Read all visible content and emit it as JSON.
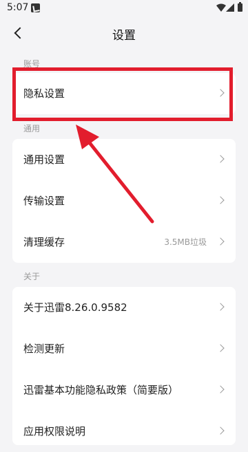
{
  "status": {
    "time": "5:07"
  },
  "header": {
    "title": "设置",
    "back_icon": "chevron-left-icon"
  },
  "sections": {
    "account": {
      "label": "账号",
      "rows": [
        {
          "label": "隐私设置"
        }
      ]
    },
    "general": {
      "label": "通用",
      "rows": [
        {
          "label": "通用设置"
        },
        {
          "label": "传输设置"
        },
        {
          "label": "清理缓存",
          "value": "3.5MB垃圾"
        }
      ]
    },
    "about": {
      "label": "关于",
      "rows": [
        {
          "label": "关于迅雷8.26.0.9582"
        },
        {
          "label": "检测更新"
        },
        {
          "label": "迅雷基本功能隐私政策（简要版）"
        },
        {
          "label": "应用权限说明"
        }
      ]
    }
  },
  "annotation": {
    "color": "#e21d2d"
  }
}
